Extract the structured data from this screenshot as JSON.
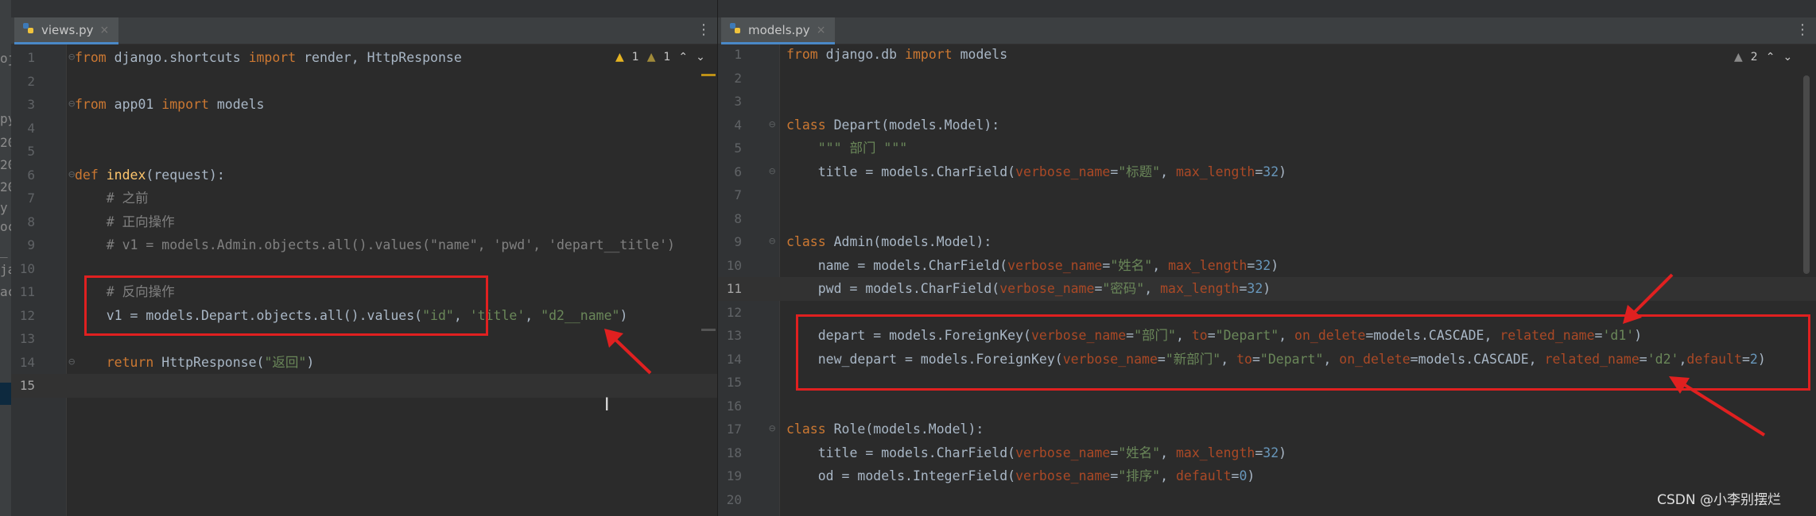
{
  "left_strip": {
    "fragments": [
      "oj",
      "py",
      "20",
      "20",
      "20",
      "y",
      "oc",
      "_",
      "ja",
      "ac"
    ]
  },
  "left_editor": {
    "tab_label": "views.py",
    "tab_close": "×",
    "menu_glyph": "⋮",
    "inspections": {
      "warning_count": "1",
      "weak_count": "1",
      "up": "⌃",
      "down": "⌄"
    },
    "lines": [
      {
        "n": "1",
        "tokens": [
          {
            "t": "from",
            "c": "kw"
          },
          {
            "t": " django.shortcuts ",
            "c": ""
          },
          {
            "t": "import",
            "c": "kw"
          },
          {
            "t": " render, HttpResponse",
            "c": ""
          }
        ]
      },
      {
        "n": "2",
        "tokens": []
      },
      {
        "n": "3",
        "tokens": [
          {
            "t": "from",
            "c": "kw"
          },
          {
            "t": " app01 ",
            "c": ""
          },
          {
            "t": "import",
            "c": "kw"
          },
          {
            "t": " models",
            "c": ""
          }
        ]
      },
      {
        "n": "4",
        "tokens": []
      },
      {
        "n": "5",
        "tokens": []
      },
      {
        "n": "6",
        "tokens": [
          {
            "t": "def",
            "c": "kw"
          },
          {
            "t": " ",
            "c": ""
          },
          {
            "t": "index",
            "c": "fn"
          },
          {
            "t": "(request):",
            "c": ""
          }
        ]
      },
      {
        "n": "7",
        "tokens": [
          {
            "t": "    # 之前",
            "c": "cm"
          }
        ]
      },
      {
        "n": "8",
        "tokens": [
          {
            "t": "    # 正向操作",
            "c": "cm"
          }
        ]
      },
      {
        "n": "9",
        "tokens": [
          {
            "t": "    # v1 = models.Admin.objects.all().values(\"name\", 'pwd', 'depart__title')",
            "c": "cm"
          }
        ]
      },
      {
        "n": "10",
        "tokens": []
      },
      {
        "n": "11",
        "tokens": [
          {
            "t": "    # 反向操作",
            "c": "cm"
          }
        ]
      },
      {
        "n": "12",
        "tokens": [
          {
            "t": "    v1 = models.Depart.objects.all().values(",
            "c": ""
          },
          {
            "t": "\"id\"",
            "c": "str"
          },
          {
            "t": ", ",
            "c": ""
          },
          {
            "t": "'title'",
            "c": "str"
          },
          {
            "t": ", ",
            "c": ""
          },
          {
            "t": "\"d2__name\"",
            "c": "str"
          },
          {
            "t": ")",
            "c": ""
          }
        ]
      },
      {
        "n": "13",
        "tokens": []
      },
      {
        "n": "14",
        "tokens": [
          {
            "t": "    ",
            "c": ""
          },
          {
            "t": "return",
            "c": "kw"
          },
          {
            "t": " HttpResponse(",
            "c": ""
          },
          {
            "t": "\"返回\"",
            "c": "str"
          },
          {
            "t": ")",
            "c": ""
          }
        ]
      },
      {
        "n": "15",
        "tokens": []
      }
    ]
  },
  "right_editor": {
    "tab_label": "models.py",
    "tab_close": "×",
    "menu_glyph": "⋮",
    "inspections": {
      "warning_count": "2",
      "up": "⌃",
      "down": "⌄"
    },
    "lines": [
      {
        "n": "1",
        "tokens": [
          {
            "t": "from",
            "c": "kw"
          },
          {
            "t": " django.db ",
            "c": ""
          },
          {
            "t": "import",
            "c": "kw"
          },
          {
            "t": " models",
            "c": ""
          }
        ]
      },
      {
        "n": "2",
        "tokens": []
      },
      {
        "n": "3",
        "tokens": []
      },
      {
        "n": "4",
        "tokens": [
          {
            "t": "class",
            "c": "kw"
          },
          {
            "t": " Depart(models.Model):",
            "c": ""
          }
        ]
      },
      {
        "n": "5",
        "tokens": [
          {
            "t": "    \"\"\" 部门 \"\"\"",
            "c": "str"
          }
        ]
      },
      {
        "n": "6",
        "tokens": [
          {
            "t": "    title = models.CharField(",
            "c": ""
          },
          {
            "t": "verbose_name",
            "c": "kwarg"
          },
          {
            "t": "=",
            "c": ""
          },
          {
            "t": "\"标题\"",
            "c": "str"
          },
          {
            "t": ", ",
            "c": ""
          },
          {
            "t": "max_length",
            "c": "kwarg"
          },
          {
            "t": "=",
            "c": ""
          },
          {
            "t": "32",
            "c": "num"
          },
          {
            "t": ")",
            "c": ""
          }
        ]
      },
      {
        "n": "7",
        "tokens": []
      },
      {
        "n": "8",
        "tokens": []
      },
      {
        "n": "9",
        "tokens": [
          {
            "t": "class",
            "c": "kw"
          },
          {
            "t": " Admin(models.Model):",
            "c": ""
          }
        ]
      },
      {
        "n": "10",
        "tokens": [
          {
            "t": "    name = models.CharField(",
            "c": ""
          },
          {
            "t": "verbose_name",
            "c": "kwarg"
          },
          {
            "t": "=",
            "c": ""
          },
          {
            "t": "\"姓名\"",
            "c": "str"
          },
          {
            "t": ", ",
            "c": ""
          },
          {
            "t": "max_length",
            "c": "kwarg"
          },
          {
            "t": "=",
            "c": ""
          },
          {
            "t": "32",
            "c": "num"
          },
          {
            "t": ")",
            "c": ""
          }
        ]
      },
      {
        "n": "11",
        "tokens": [
          {
            "t": "    pwd = models.CharField(",
            "c": ""
          },
          {
            "t": "verbose_name",
            "c": "kwarg"
          },
          {
            "t": "=",
            "c": ""
          },
          {
            "t": "\"密码\"",
            "c": "str"
          },
          {
            "t": ", ",
            "c": ""
          },
          {
            "t": "max_length",
            "c": "kwarg"
          },
          {
            "t": "=",
            "c": ""
          },
          {
            "t": "32",
            "c": "num"
          },
          {
            "t": ")",
            "c": ""
          }
        ]
      },
      {
        "n": "12",
        "tokens": []
      },
      {
        "n": "13",
        "tokens": [
          {
            "t": "    depart = models.ForeignKey(",
            "c": ""
          },
          {
            "t": "verbose_name",
            "c": "kwarg"
          },
          {
            "t": "=",
            "c": ""
          },
          {
            "t": "\"部门\"",
            "c": "str"
          },
          {
            "t": ", ",
            "c": ""
          },
          {
            "t": "to",
            "c": "kwarg"
          },
          {
            "t": "=",
            "c": ""
          },
          {
            "t": "\"Depart\"",
            "c": "str"
          },
          {
            "t": ", ",
            "c": ""
          },
          {
            "t": "on_delete",
            "c": "kwarg"
          },
          {
            "t": "=models.CASCADE, ",
            "c": ""
          },
          {
            "t": "related_name",
            "c": "kwarg"
          },
          {
            "t": "=",
            "c": ""
          },
          {
            "t": "'d1'",
            "c": "str"
          },
          {
            "t": ")",
            "c": ""
          }
        ]
      },
      {
        "n": "14",
        "tokens": [
          {
            "t": "    new_depart = models.ForeignKey(",
            "c": ""
          },
          {
            "t": "verbose_name",
            "c": "kwarg"
          },
          {
            "t": "=",
            "c": ""
          },
          {
            "t": "\"新部门\"",
            "c": "str"
          },
          {
            "t": ", ",
            "c": ""
          },
          {
            "t": "to",
            "c": "kwarg"
          },
          {
            "t": "=",
            "c": ""
          },
          {
            "t": "\"Depart\"",
            "c": "str"
          },
          {
            "t": ", ",
            "c": ""
          },
          {
            "t": "on_delete",
            "c": "kwarg"
          },
          {
            "t": "=models.CASCADE, ",
            "c": ""
          },
          {
            "t": "related_name",
            "c": "kwarg"
          },
          {
            "t": "=",
            "c": ""
          },
          {
            "t": "'d2'",
            "c": "str"
          },
          {
            "t": ",",
            "c": ""
          },
          {
            "t": "default",
            "c": "kwarg"
          },
          {
            "t": "=",
            "c": ""
          },
          {
            "t": "2",
            "c": "num"
          },
          {
            "t": ")",
            "c": ""
          }
        ]
      },
      {
        "n": "15",
        "tokens": []
      },
      {
        "n": "16",
        "tokens": []
      },
      {
        "n": "17",
        "tokens": [
          {
            "t": "class",
            "c": "kw"
          },
          {
            "t": " Role(models.Model):",
            "c": ""
          }
        ]
      },
      {
        "n": "18",
        "tokens": [
          {
            "t": "    title = models.CharField(",
            "c": ""
          },
          {
            "t": "verbose_name",
            "c": "kwarg"
          },
          {
            "t": "=",
            "c": ""
          },
          {
            "t": "\"姓名\"",
            "c": "str"
          },
          {
            "t": ", ",
            "c": ""
          },
          {
            "t": "max_length",
            "c": "kwarg"
          },
          {
            "t": "=",
            "c": ""
          },
          {
            "t": "32",
            "c": "num"
          },
          {
            "t": ")",
            "c": ""
          }
        ]
      },
      {
        "n": "19",
        "tokens": [
          {
            "t": "    od = models.IntegerField(",
            "c": ""
          },
          {
            "t": "verbose_name",
            "c": "kwarg"
          },
          {
            "t": "=",
            "c": ""
          },
          {
            "t": "\"排序\"",
            "c": "str"
          },
          {
            "t": ", ",
            "c": ""
          },
          {
            "t": "default",
            "c": "kwarg"
          },
          {
            "t": "=",
            "c": ""
          },
          {
            "t": "0",
            "c": "num"
          },
          {
            "t": ")",
            "c": ""
          }
        ]
      },
      {
        "n": "20",
        "tokens": []
      }
    ]
  },
  "watermark": "CSDN @小李别摆烂",
  "colors": {
    "annotation": "#e02020",
    "editor_bg": "#2b2b2b",
    "keyword": "#cc7832",
    "string": "#6a8759"
  }
}
